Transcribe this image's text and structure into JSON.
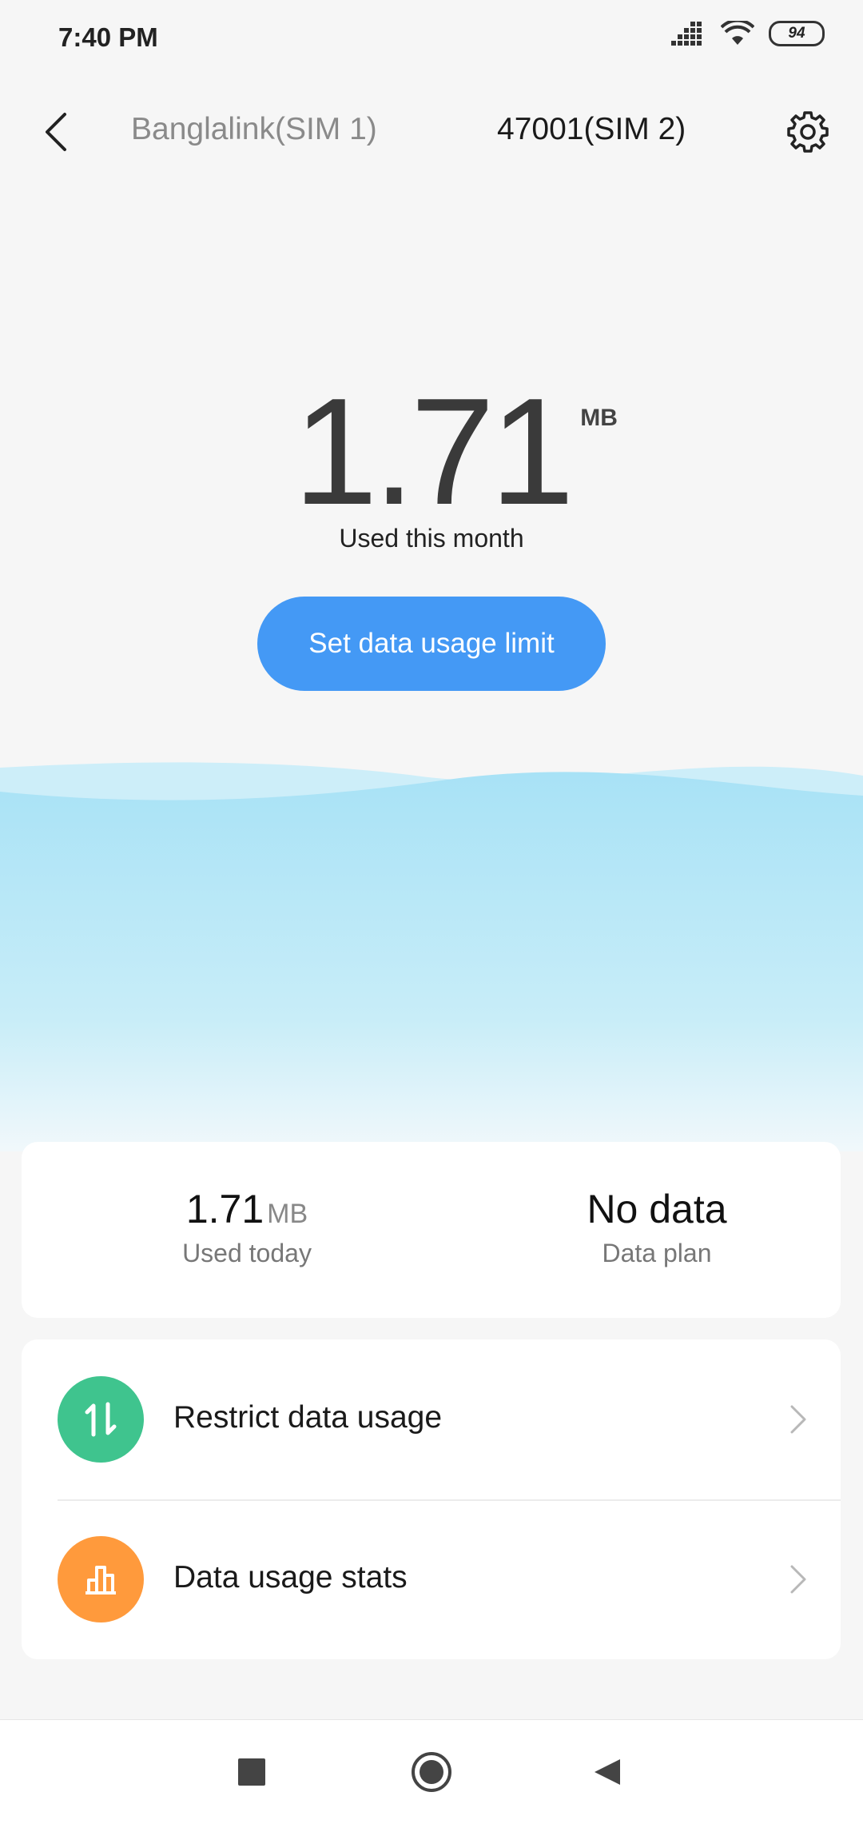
{
  "status_bar": {
    "time": "7:40 PM",
    "battery": "94"
  },
  "tabs": {
    "sim1": "Banglalink(SIM 1)",
    "sim2": "47001(SIM 2)"
  },
  "usage": {
    "value": "1.71",
    "unit": "MB",
    "caption": "Used this month"
  },
  "limit_button": {
    "label": "Set data usage limit"
  },
  "summary": {
    "today_value": "1.71",
    "today_unit": "MB",
    "today_label": "Used today",
    "plan_value": "No data",
    "plan_label": "Data plan"
  },
  "menu": {
    "items": [
      {
        "label": "Restrict data usage",
        "icon": "restrict-icon",
        "color": "#3fc48e"
      },
      {
        "label": "Data usage stats",
        "icon": "stats-icon",
        "color": "#ff9a3c"
      }
    ]
  },
  "colors": {
    "accent": "#4499f5",
    "wave": "#a9e2f5"
  }
}
